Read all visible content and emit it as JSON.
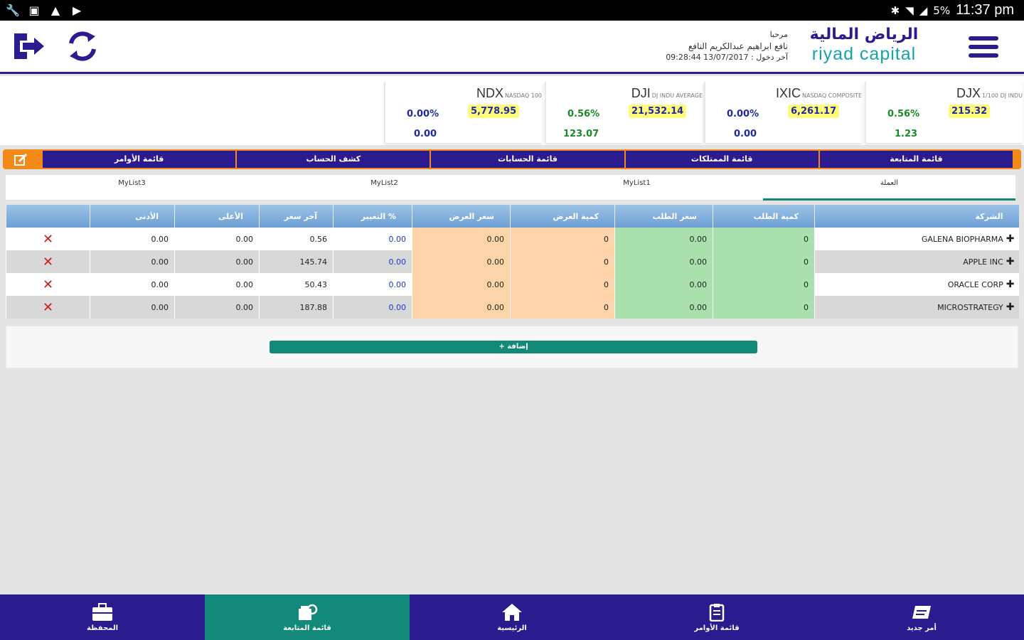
{
  "status_bar": {
    "time": "11:37 pm",
    "battery": "5%"
  },
  "header": {
    "logo_ar": "الرياض المالية",
    "logo_en": "riyad capital",
    "greeting": "مرحبا",
    "user_name": "نافع ابراهيم عبدالكريم النافع",
    "last_login": "آخر دخول : 13/07/2017 09:28:44"
  },
  "indices": [
    {
      "symbol": "DJX",
      "subtitle": "1/100 DJ INDU",
      "value": "215.32",
      "change_pct": "0.56%",
      "change": "1.23",
      "color": "#1a8a2a"
    },
    {
      "symbol": "IXIC",
      "subtitle": "NASDAQ COMPOSITE",
      "value": "6,261.17",
      "change_pct": "0.00%",
      "change": "0.00",
      "color": "#1f2a9c"
    },
    {
      "symbol": "DJI",
      "subtitle": "DJ INDU AVERAGE",
      "value": "21,532.14",
      "change_pct": "0.56%",
      "change": "123.07",
      "color": "#1a8a2a"
    },
    {
      "symbol": "NDX",
      "subtitle": "NASDAQ 100",
      "value": "5,778.95",
      "change_pct": "0.00%",
      "change": "0.00",
      "color": "#1f2a9c"
    }
  ],
  "main_tabs": [
    "قائمة الأوامر",
    "كشف الحساب",
    "قائمة الحسابات",
    "قائمة الممتلكات",
    "قائمة المتابعة"
  ],
  "list_tabs": [
    "MyList3",
    "MyList2",
    "MyList1",
    "العملة"
  ],
  "table": {
    "headers": [
      "",
      "الأدنى",
      "الأعلى",
      "آخر سعر",
      "التغيير %",
      "سعر العرض",
      "كمية العرض",
      "سعر الطلب",
      "كمية الطلب",
      "الشركة"
    ],
    "rows": [
      {
        "low": "0.00",
        "high": "0.00",
        "last": "0.56",
        "chg": "0.00",
        "ask_price": "0.00",
        "ask_qty": "0",
        "bid_price": "0.00",
        "bid_qty": "0",
        "company": "GALENA BIOPHARMA"
      },
      {
        "low": "0.00",
        "high": "0.00",
        "last": "145.74",
        "chg": "0.00",
        "ask_price": "0.00",
        "ask_qty": "0",
        "bid_price": "0.00",
        "bid_qty": "0",
        "company": "APPLE INC"
      },
      {
        "low": "0.00",
        "high": "0.00",
        "last": "50.43",
        "chg": "0.00",
        "ask_price": "0.00",
        "ask_qty": "0",
        "bid_price": "0.00",
        "bid_qty": "0",
        "company": "ORACLE CORP"
      },
      {
        "low": "0.00",
        "high": "0.00",
        "last": "187.88",
        "chg": "0.00",
        "ask_price": "0.00",
        "ask_qty": "0",
        "bid_price": "0.00",
        "bid_qty": "0",
        "company": "MICROSTRATEGY"
      }
    ]
  },
  "add_button": "+ إضافة",
  "bottom_nav": [
    "المحفظة",
    "قائمة المتابعة",
    "الرئيسية",
    "قائمة الأوامر",
    "أمر جديد"
  ],
  "colors": {
    "primary": "#2a1b8f",
    "accent": "#138a79",
    "orange": "#f28a1a",
    "bid": "#a9e0ad",
    "ask": "#fdd4aa"
  }
}
